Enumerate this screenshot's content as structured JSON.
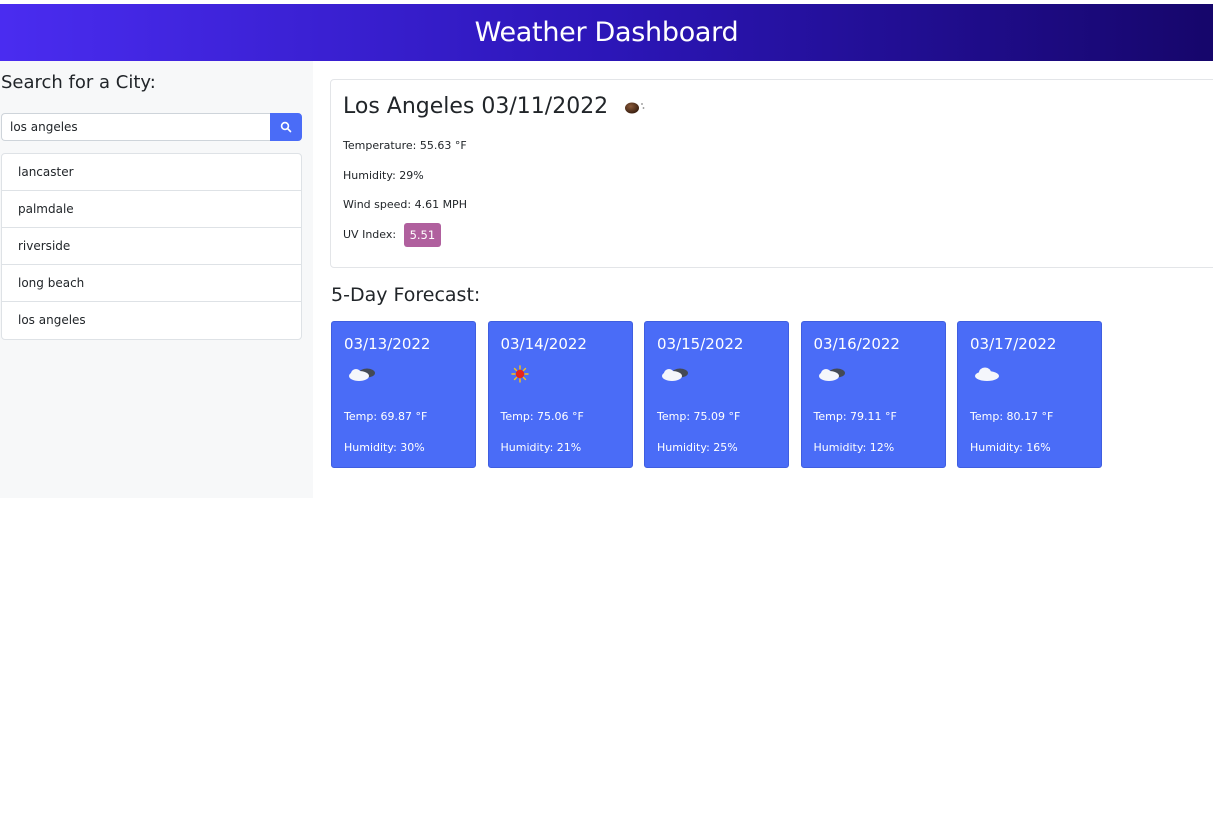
{
  "header": {
    "title": "Weather Dashboard"
  },
  "search": {
    "title": "Search for a City:",
    "value": "los angeles",
    "button_icon": "search-icon"
  },
  "history": [
    "lancaster",
    "palmdale",
    "riverside",
    "long beach",
    "los angeles"
  ],
  "current": {
    "title": "Los Angeles 03/11/2022",
    "icon": "moon-icon",
    "temperature": "Temperature: 55.63 °F",
    "humidity": "Humidity: 29%",
    "wind": "Wind speed: 4.61 MPH",
    "uv_label": "UV Index:",
    "uv_value": "5.51",
    "uv_color": "#b0609e"
  },
  "forecast": {
    "title": "5-Day Forecast:",
    "card_color": "#4a6cf7",
    "days": [
      {
        "date": "03/13/2022",
        "icon": "partly-cloudy-icon",
        "temp": "Temp: 69.87 °F",
        "humidity": "Humidity: 30%"
      },
      {
        "date": "03/14/2022",
        "icon": "sun-icon",
        "temp": "Temp: 75.06 °F",
        "humidity": "Humidity: 21%"
      },
      {
        "date": "03/15/2022",
        "icon": "partly-cloudy-icon",
        "temp": "Temp: 75.09 °F",
        "humidity": "Humidity: 25%"
      },
      {
        "date": "03/16/2022",
        "icon": "partly-cloudy-icon",
        "temp": "Temp: 79.11 °F",
        "humidity": "Humidity: 12%"
      },
      {
        "date": "03/17/2022",
        "icon": "cloud-icon",
        "temp": "Temp: 80.17 °F",
        "humidity": "Humidity: 16%"
      }
    ]
  }
}
